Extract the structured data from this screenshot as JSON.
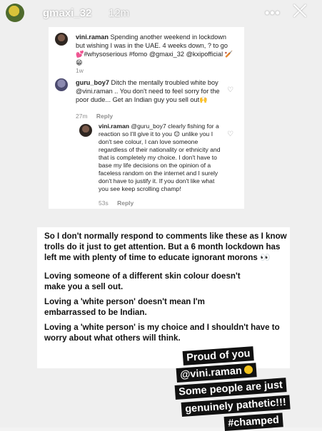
{
  "story": {
    "username": "gmaxi_32",
    "time": "12m",
    "more": "•••",
    "close": "close"
  },
  "comments": [
    {
      "user": "vini.raman",
      "text": "Spending another weekend in lockdown but wishing I was in the UAE. 4 weeks down, ? to go 💕#whysoserious #fomo @gmaxi_32 @kxipofficial 🏏😁",
      "meta": "1w"
    },
    {
      "user": "guru_boy7",
      "text": "Ditch the mentally troubled white boy @vini.raman .. You don't need to feel sorry for the poor dude... Get an Indian guy you sell out🙌",
      "meta": "27m",
      "reply": "Reply"
    },
    {
      "user": "vini.raman",
      "text": "@guru_boy7 clearly fishing for a reaction so I'll give it to you 😊 unlike you I don't see colour, I can love someone regardless of their nationality or ethnicity and that is completely my choice. I don't have to base my life decisions on the opinion of a faceless random on the internet and I surely don't have to justify it. If you don't like what you see keep scrolling champ!",
      "meta": "53s",
      "reply": "Reply"
    }
  ],
  "statement": {
    "p1": "So I don't normally respond to comments like these as I know trolls do it just to get attention. But a 6 month lockdown has left me with plenty of time to educate ignorant morons 👀",
    "p2": "Loving someone of a different skin colour doesn't make you a sell out.",
    "p3": "Loving a 'white person' doesn't mean I'm embarrassed to be Indian.",
    "p4": "Loving a 'white person' is my choice and I shouldn't have to worry about what others will think."
  },
  "sticker": {
    "line1": "Proud of you",
    "line2": "@vini.raman",
    "line3": "Some people are just",
    "line4": "genuinely pathetic!!!",
    "line5": "#champed"
  }
}
